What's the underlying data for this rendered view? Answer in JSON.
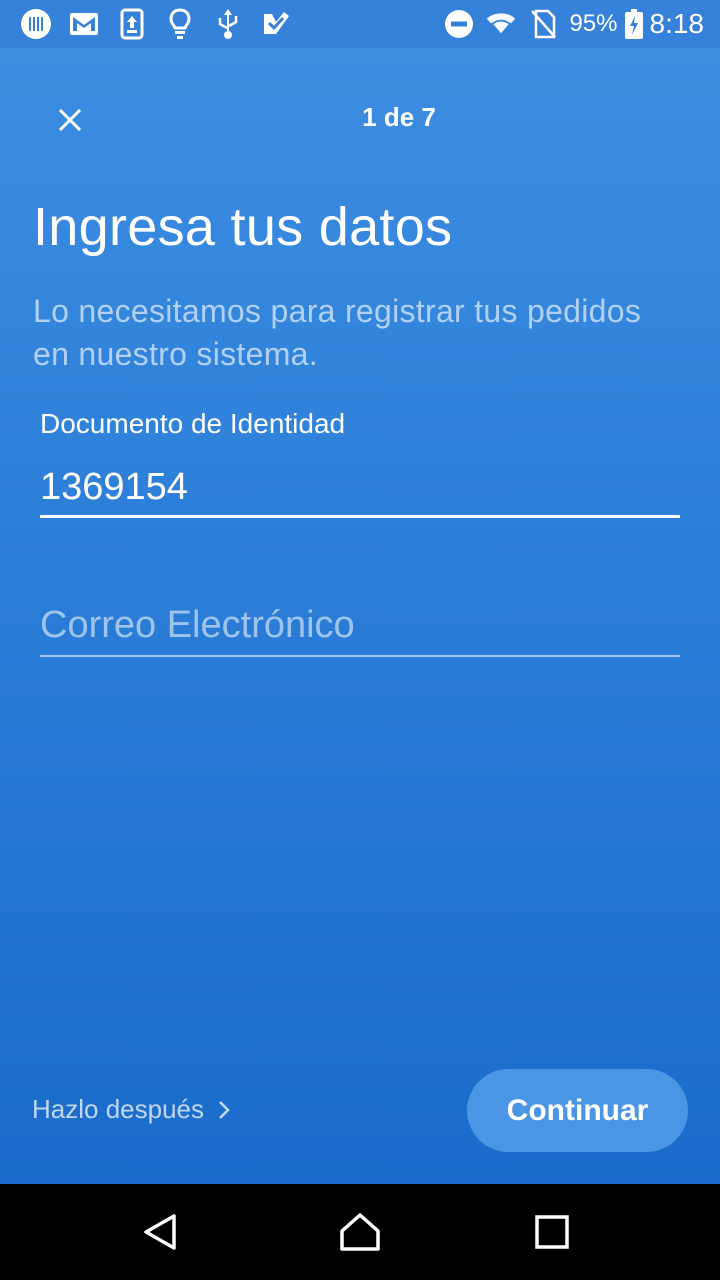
{
  "status_bar": {
    "icons_left": [
      "barcode-app-icon",
      "gmail-icon",
      "upload-icon",
      "lightbulb-icon",
      "usb-icon",
      "check-app-icon"
    ],
    "icons_right": [
      "do-not-disturb-icon",
      "wifi-icon",
      "no-sim-icon"
    ],
    "battery": "95%",
    "time": "8:18"
  },
  "header": {
    "close_icon": "close-icon",
    "step": "1 de 7"
  },
  "main": {
    "title": "Ingresa tus datos",
    "subtitle": "Lo necesitamos para registrar tus pedidos en nuestro sistema.",
    "document_field": {
      "label": "Documento de Identidad",
      "value": "1369154"
    },
    "email_field": {
      "placeholder": "Correo Electrónico",
      "value": ""
    }
  },
  "footer": {
    "later_label": "Hazlo después",
    "continue_label": "Continuar"
  },
  "nav": {
    "back": "back-icon",
    "home": "home-icon",
    "recent": "recent-apps-icon"
  },
  "colors": {
    "background_top": "#3f8fe2",
    "background_bottom": "#1a6bcb",
    "button": "#4a95e4"
  }
}
